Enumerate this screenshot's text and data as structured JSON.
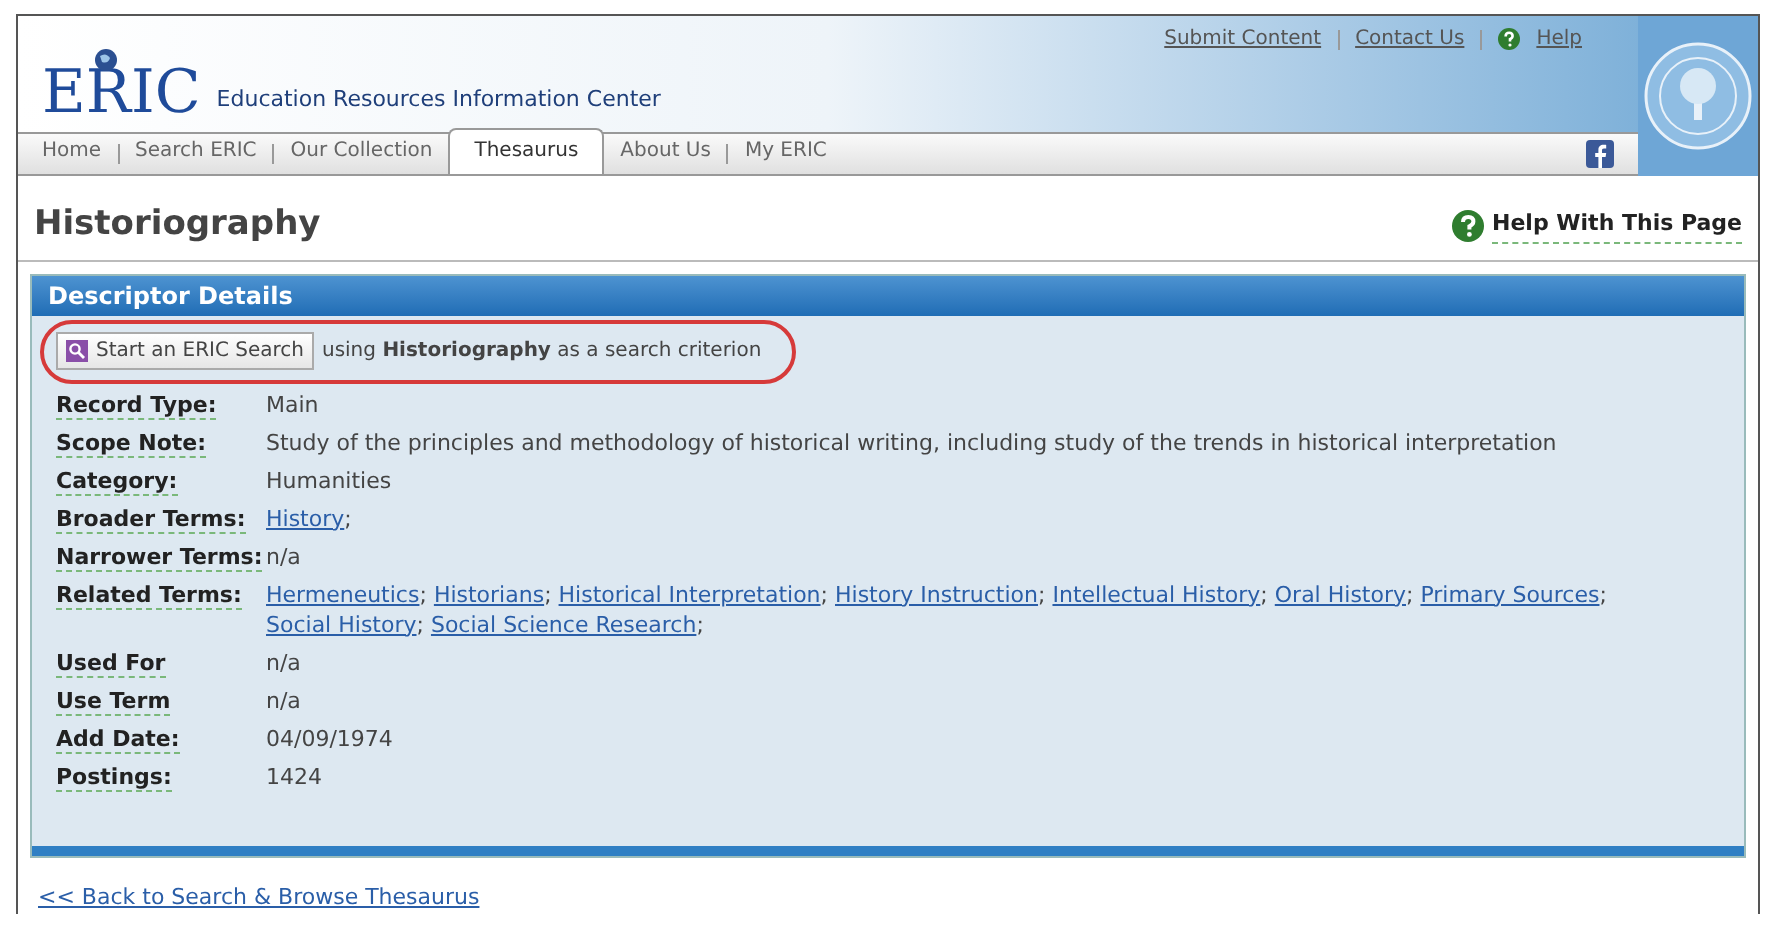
{
  "logo": {
    "text": "ERIC",
    "tagline": "Education Resources Information Center"
  },
  "top_links": [
    {
      "label": "Submit Content",
      "kind": "link"
    },
    {
      "label": "Contact Us",
      "kind": "link"
    },
    {
      "label": "Help",
      "kind": "help"
    }
  ],
  "tabs": [
    {
      "label": "Home",
      "selected": false
    },
    {
      "label": "Search ERIC",
      "selected": false
    },
    {
      "label": "Our Collection",
      "selected": false
    },
    {
      "label": "Thesaurus",
      "selected": true
    },
    {
      "label": "About Us",
      "selected": false
    },
    {
      "label": "My ERIC",
      "selected": false
    }
  ],
  "page_title": "Historiography",
  "help_link": "Help With This Page",
  "panel": {
    "title": "Descriptor Details",
    "search_button": "Start an ERIC Search",
    "search_note": "using **Historiography** as a search criterion",
    "fields": [
      {
        "label": "Record Type:",
        "kind": "text",
        "value": "Main"
      },
      {
        "label": "Scope Note:",
        "kind": "text",
        "value": "Study of the principles and methodology of historical writing, including study of the trends in historical interpretation"
      },
      {
        "label": "Category:",
        "kind": "text",
        "value": "Humanities"
      },
      {
        "label": "Broader Terms:",
        "kind": "links",
        "separator": ";",
        "links": [
          "History"
        ]
      },
      {
        "label": "Narrower Terms:",
        "kind": "text",
        "value": "n/a"
      },
      {
        "label": "Related Terms:",
        "kind": "links",
        "separator": ";",
        "links": [
          "Hermeneutics",
          "Historians",
          "Historical Interpretation",
          "History Instruction",
          "Intellectual History",
          "Oral History",
          "Primary Sources",
          "Social History",
          "Social Science Research"
        ]
      },
      {
        "label": "Used For",
        "kind": "text",
        "value": "n/a"
      },
      {
        "label": "Use Term",
        "kind": "text",
        "value": "n/a"
      },
      {
        "label": "Add Date:",
        "kind": "text",
        "value": "04/09/1974"
      },
      {
        "label": "Postings:",
        "kind": "text",
        "value": "1424"
      }
    ]
  },
  "back_link": "<< Back to Search & Browse Thesaurus"
}
